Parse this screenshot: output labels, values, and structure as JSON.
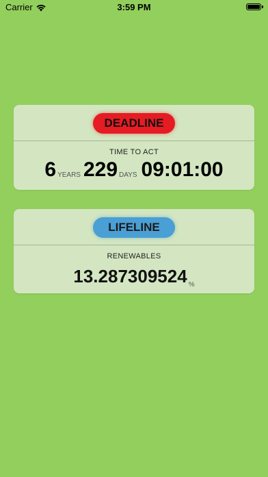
{
  "status_bar": {
    "carrier": "Carrier",
    "time": "3:59 PM",
    "wifi_icon": "wifi-icon",
    "battery_icon": "battery-icon"
  },
  "deadline": {
    "title": "DEADLINE",
    "subtitle": "TIME TO ACT",
    "years_value": "6",
    "years_label": "YEARS",
    "days_value": "229",
    "days_label": "DAYS",
    "clock": "09:01:00",
    "accent_color": "#e51c23"
  },
  "lifeline": {
    "title": "LIFELINE",
    "subtitle": "RENEWABLES",
    "value": "13.287309524",
    "unit": "%",
    "accent_color": "#4a9fd4"
  },
  "colors": {
    "background": "#92cf5c"
  }
}
